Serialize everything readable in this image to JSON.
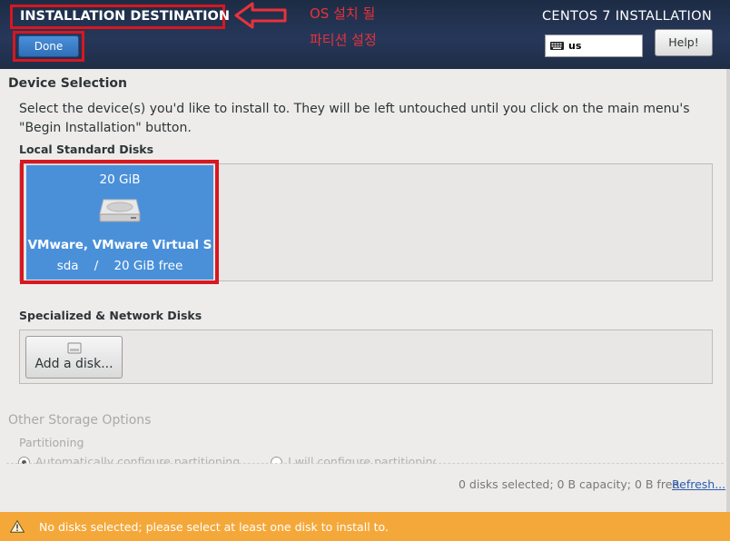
{
  "header": {
    "title": "INSTALLATION DESTINATION",
    "done_label": "Done",
    "product_title": "CENTOS 7 INSTALLATION",
    "keyboard_layout": "us",
    "help_label": "Help!",
    "annotation_line1": "OS 설치 될",
    "annotation_line2": "파티션 설정",
    "annotation_color": "#e8323a"
  },
  "device_selection": {
    "title": "Device Selection",
    "description": "Select the device(s) you'd like to install to.  They will be left untouched until you click on the main menu's \"Begin Installation\" button.",
    "local_label": "Local Standard Disks",
    "disks": [
      {
        "size": "20 GiB",
        "name": "VMware, VMware Virtual S",
        "info": "sda    /    20 GiB free"
      }
    ],
    "specialized_label": "Specialized & Network Disks",
    "add_disk_label": "Add a disk..."
  },
  "other_storage": {
    "title": "Other Storage Options",
    "partitioning_label": "Partitioning",
    "option_auto": "Automatically configure partitioning.",
    "option_manual": "I will configure partitioning."
  },
  "footer": {
    "summary": "0 disks selected; 0 B capacity; 0 B free",
    "refresh_label": "Refresh..."
  },
  "warning": {
    "text": "No disks selected; please select at least one disk to install to.",
    "icon": "warning-icon",
    "color": "#f5a83a"
  },
  "colors": {
    "accent": "#4a90d9",
    "highlight_border": "#d8171f"
  }
}
